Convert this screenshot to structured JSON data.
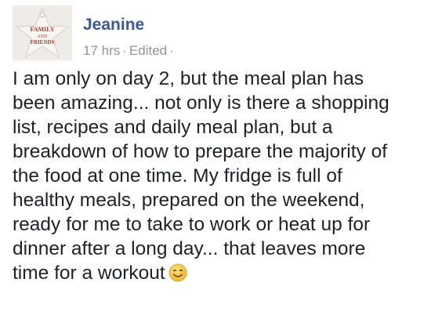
{
  "post": {
    "author_name": "Jeanine",
    "timestamp": "17 hrs",
    "edited_label": "Edited",
    "separator": "·",
    "privacy_dot": "·",
    "avatar": {
      "icon": "star-ornament-avatar",
      "text_lines": [
        "FAMILY",
        "AND",
        "FRIENDS"
      ]
    },
    "body_lines": [
      "I am only on day 2, but the meal plan has",
      "been amazing... not only is there a shopping",
      "list, recipes and daily meal plan, but a",
      "breakdown of how to prepare the majority of",
      "the food at one time. My fridge is full of",
      "healthy meals, prepared on the weekend,",
      "ready for me to take to work or heat up for",
      "dinner after a long day... that leaves more",
      "time for a workout"
    ],
    "emoji": "smiling-face-emoji"
  },
  "colors": {
    "author": "#3b5998",
    "meta": "#90949c",
    "body": "#1d2129",
    "emoji_face": "#f5c542"
  }
}
